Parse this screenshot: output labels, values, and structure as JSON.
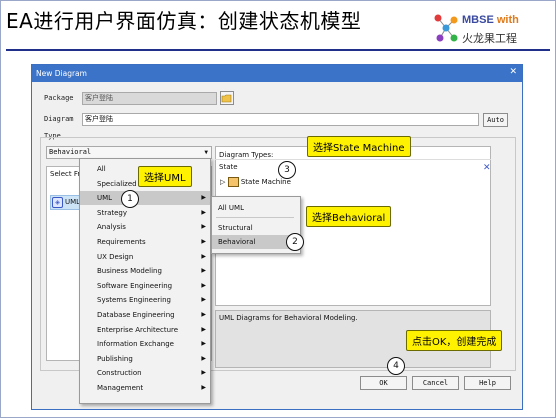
{
  "slide": {
    "title": "EA进行用户界面仿真：创建状态机模型"
  },
  "logo": {
    "line1": "MBSE",
    "with": "with",
    "line2": "火龙果工程"
  },
  "dialog": {
    "title": "New Diagram",
    "package_label": "Package",
    "package_value": "客户登陆",
    "diagram_label": "Diagram",
    "diagram_value": "客户登陆",
    "auto_button": "Auto",
    "type_label": "Type",
    "type_select": "Behavioral",
    "select_from_label": "Select Fr",
    "uml_item": "UML",
    "diagram_types_label": "Diagram Types:",
    "state_group": "State",
    "state_machine": "State Machine",
    "description": "UML Diagrams for Behavioral Modeling.",
    "ok": "OK",
    "cancel": "Cancel",
    "help": "Help"
  },
  "menu": {
    "items": [
      "All",
      "Specialized",
      "UML",
      "Strategy",
      "Analysis",
      "Requirements",
      "UX Design",
      "Business Modeling",
      "Software Engineering",
      "Systems Engineering",
      "Database Engineering",
      "Enterprise Architecture",
      "Information Exchange",
      "Publishing",
      "Construction",
      "Management"
    ]
  },
  "submenu": {
    "items": [
      "All UML",
      "Structural",
      "Behavioral"
    ]
  },
  "callouts": {
    "c1": "选择UML",
    "c2": "选择Behavioral",
    "c3": "选择State Machine",
    "c4": "点击OK，创建完成",
    "n1": "1",
    "n2": "2",
    "n3": "3",
    "n4": "4"
  }
}
